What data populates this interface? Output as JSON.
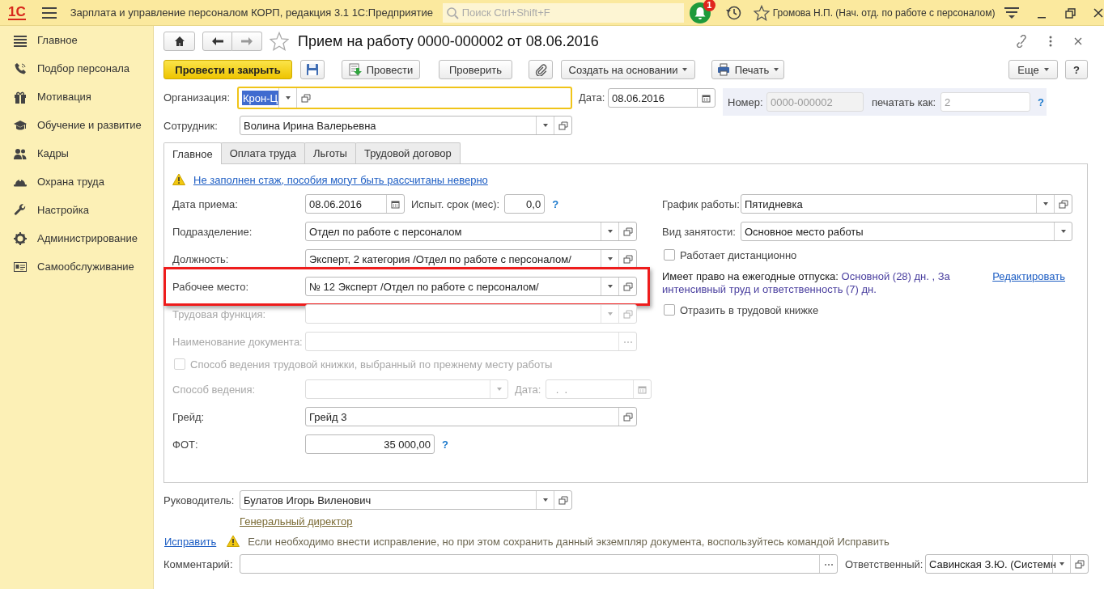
{
  "app": {
    "logo": "1С",
    "title": "Зарплата и управление персоналом КОРП, редакция 3.1 1С:Предприятие",
    "search": {
      "placeholder": "Поиск Ctrl+Shift+F"
    },
    "notifications": "1",
    "user": "Громова Н.П. (Нач. отд. по работе с персоналом)"
  },
  "sidebar": {
    "items": [
      {
        "label": "Главное"
      },
      {
        "label": "Подбор персонала"
      },
      {
        "label": "Мотивация"
      },
      {
        "label": "Обучение и развитие"
      },
      {
        "label": "Кадры"
      },
      {
        "label": "Охрана труда"
      },
      {
        "label": "Настройка"
      },
      {
        "label": "Администрирование"
      },
      {
        "label": "Самообслуживание"
      }
    ]
  },
  "document": {
    "title": "Прием на работу 0000-000002 от 08.06.2016",
    "favorite": false
  },
  "toolbar": {
    "left": [
      {
        "kind": "primary",
        "label": "Провести и закрыть"
      },
      {
        "kind": "save"
      },
      {
        "kind": "post",
        "label": "Провести"
      },
      {
        "kind": "plain",
        "label": "Проверить"
      },
      {
        "kind": "attach"
      },
      {
        "kind": "menu",
        "label": "Создать на основании"
      },
      {
        "kind": "print",
        "label": "Печать"
      }
    ],
    "right": [
      {
        "kind": "menu",
        "label": "Еще"
      },
      {
        "kind": "plain",
        "label": "?"
      }
    ]
  },
  "header": {
    "organization": {
      "label": "Организация:",
      "value": "Крон-Ц",
      "focused": true,
      "text_selected": true
    },
    "date": {
      "label": "Дата:",
      "value": "08.06.2016"
    },
    "number": {
      "label": "Номер:",
      "value": "0000-000002"
    },
    "print_as": {
      "label": "печатать как:",
      "value": "2",
      "help": "?"
    },
    "employee": {
      "label": "Сотрудник:",
      "value": "Волина Ирина Валерьевна"
    }
  },
  "tabs": [
    {
      "label": "Главное",
      "selected": true
    },
    {
      "label": "Оплата труда",
      "selected": false
    },
    {
      "label": "Льготы",
      "selected": false
    },
    {
      "label": "Трудовой договор",
      "selected": false
    }
  ],
  "warning": {
    "text": "Не заполнен стаж, пособия могут быть рассчитаны неверно"
  },
  "left_rows": [
    {
      "kind": "field",
      "label": "Дата приема:",
      "field": {
        "kind": "date",
        "value": "08.06.2016"
      },
      "extra": {
        "label": "Испыт. срок (мес):",
        "field": {
          "kind": "number",
          "value": "0,0"
        },
        "help": "?"
      }
    },
    {
      "kind": "field",
      "label": "Подразделение:",
      "field": {
        "kind": "lookup",
        "value": "Отдел по работе с персоналом"
      }
    },
    {
      "kind": "field",
      "label": "Должность:",
      "field": {
        "kind": "lookup",
        "value": "Эксперт, 2 категория /Отдел по работе с персоналом/"
      }
    },
    {
      "kind": "field",
      "label": "Рабочее место:",
      "highlighted": true,
      "field": {
        "kind": "lookup",
        "value": "№ 12 Эксперт /Отдел по работе с персоналом/"
      }
    },
    {
      "kind": "field",
      "label": "Трудовая функция:",
      "disabled": true,
      "field": {
        "kind": "lookup"
      }
    },
    {
      "kind": "field",
      "label": "Наименование документа:",
      "disabled": true,
      "field": {
        "kind": "choice"
      }
    },
    {
      "kind": "checkbox",
      "label": "Способ ведения трудовой книжки, выбранный по прежнему месту работы",
      "checked": false,
      "disabled": true
    },
    {
      "kind": "field",
      "label": "Способ ведения:",
      "disabled": true,
      "field": {
        "kind": "dropdown"
      },
      "extra": {
        "label": "Дата:",
        "field": {
          "kind": "date",
          "value": "  .  ."
        }
      }
    },
    {
      "kind": "field",
      "label": "Грейд:",
      "field": {
        "kind": "ref",
        "value": "Грейд 3"
      }
    },
    {
      "kind": "field",
      "label": "ФОТ:",
      "field": {
        "kind": "number",
        "value": "35 000,00"
      },
      "help": "?"
    }
  ],
  "right_rows": [
    {
      "kind": "field",
      "label": "График работы:",
      "field": {
        "kind": "lookup",
        "value": "Пятидневка"
      }
    },
    {
      "kind": "field",
      "label": "Вид занятости:",
      "field": {
        "kind": "dropdown",
        "value": "Основное место работы"
      }
    },
    {
      "kind": "checkbox",
      "label": "Работает дистанционно",
      "checked": false
    },
    {
      "kind": "vacation",
      "label": "Имеет право на ежегодные отпуска:",
      "value": "Основной (28) дн. , За интенсивный труд и ответственность (7) дн.",
      "link": "Редактировать"
    },
    {
      "kind": "checkbox",
      "label": "Отразить в трудовой книжке",
      "checked": false
    }
  ],
  "footer": {
    "manager": {
      "label": "Руководитель:",
      "value": "Булатов Игорь Виленович",
      "position": "Генеральный директор"
    },
    "fix": {
      "link": "Исправить",
      "note": "Если необходимо внести исправление, но при этом сохранить данный экземпляр документа, воспользуйтесь командой Исправить"
    },
    "comment": {
      "label": "Комментарий:"
    },
    "responsible": {
      "label": "Ответственный:",
      "value": "Савинская З.Ю. (Системн"
    }
  }
}
